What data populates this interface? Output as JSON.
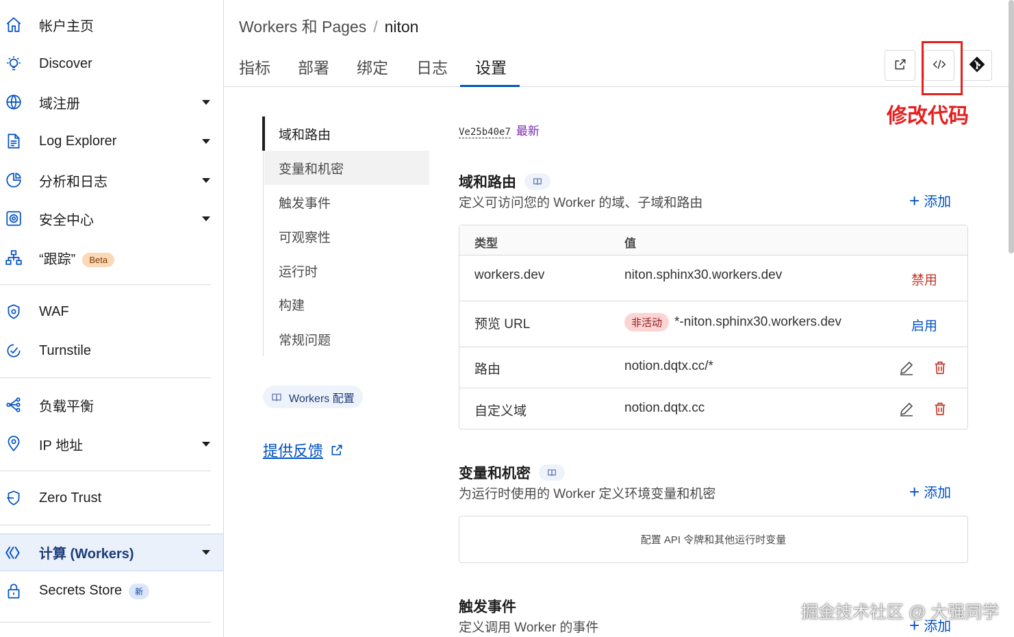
{
  "sidebar": {
    "items": [
      {
        "label": "帐户主页",
        "icon": "home-icon"
      },
      {
        "label": "Discover",
        "icon": "lightbulb-icon"
      },
      {
        "label": "域注册",
        "icon": "globe-icon"
      },
      {
        "label": "Log Explorer",
        "icon": "document-icon"
      },
      {
        "label": "分析和日志",
        "icon": "pie-chart-icon"
      },
      {
        "label": "安全中心",
        "icon": "security-center-icon"
      },
      {
        "label": "“跟踪”",
        "icon": "network-icon",
        "badge": "Beta"
      },
      {
        "label": "WAF",
        "icon": "shield-gear-icon"
      },
      {
        "label": "Turnstile",
        "icon": "check-circle-icon"
      },
      {
        "label": "负载平衡",
        "icon": "load-balancer-icon"
      },
      {
        "label": "IP 地址",
        "icon": "location-pin-icon"
      },
      {
        "label": "Zero Trust",
        "icon": "zero-trust-icon"
      },
      {
        "label": "计算 (Workers)",
        "icon": "workers-icon"
      },
      {
        "label": "Secrets Store",
        "icon": "lock-icon",
        "badge": "新"
      }
    ]
  },
  "header": {
    "breadcrumb_parent": "Workers 和 Pages",
    "breadcrumb_sep": "/",
    "breadcrumb_current": "niton",
    "tabs": [
      "指标",
      "部署",
      "绑定",
      "日志",
      "设置"
    ]
  },
  "annotation": "修改代码",
  "subnav": {
    "items": [
      "域和路由",
      "变量和机密",
      "触发事件",
      "可观察性",
      "运行时",
      "构建",
      "常规问题"
    ],
    "config_pill": "Workers 配置",
    "feedback": "提供反馈"
  },
  "version": {
    "hash": "Ve25b40e7",
    "tag": "最新"
  },
  "domains": {
    "title": "域和路由",
    "desc": "定义可访问您的 Worker 的域、子域和路由",
    "add": "添加",
    "headers": {
      "type": "类型",
      "value": "值"
    },
    "rows": [
      {
        "type": "workers.dev",
        "value": "niton.sphinx30.workers.dev",
        "action": "禁用"
      },
      {
        "type": "预览 URL",
        "status": "非活动",
        "value": "*-niton.sphinx30.workers.dev",
        "action": "启用"
      },
      {
        "type": "路由",
        "value": "notion.dqtx.cc/*"
      },
      {
        "type": "自定义域",
        "value": "notion.dqtx.cc"
      }
    ]
  },
  "variables": {
    "title": "变量和机密",
    "desc": "为运行时使用的 Worker 定义环境变量和机密",
    "add": "添加",
    "empty": "配置 API 令牌和其他运行时变量"
  },
  "triggers": {
    "title": "触发事件",
    "desc": "定义调用 Worker 的事件",
    "add": "添加"
  },
  "watermark": "掘金技术社区 @ 大强同学",
  "colors": {
    "accent": "#0051c3",
    "annotation": "#e61e1e",
    "danger": "#c0392b"
  }
}
